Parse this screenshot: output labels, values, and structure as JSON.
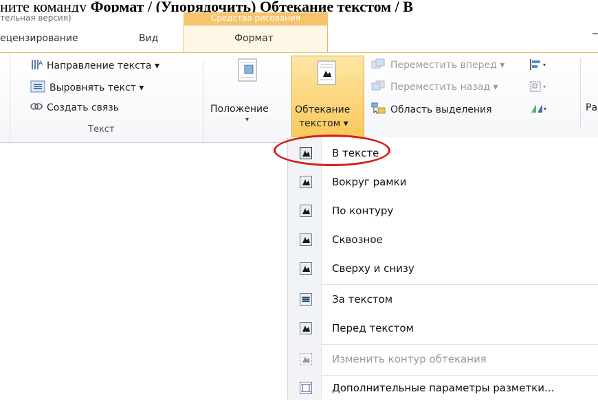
{
  "document_line": {
    "prefix": "ните команду ",
    "bold": "Формат / (Упорядочить) Обтекание текстом / В"
  },
  "ribbon": {
    "title_fragment": "тельная версия)",
    "contextual_header": "Средства рисования",
    "tabs": [
      {
        "label": "ецензирование"
      },
      {
        "label": "Вид"
      },
      {
        "label": "Формат"
      }
    ],
    "text_group": {
      "items": [
        {
          "label": "Направление текста ▾"
        },
        {
          "label": "Выровнять текст ▾"
        },
        {
          "label": "Создать связь"
        }
      ],
      "label": "Текст"
    },
    "position_button": {
      "label": "Положение",
      "arrow": "▾"
    },
    "wrap_button": {
      "line1": "Обтекание",
      "line2": "текстом ▾"
    },
    "arrange_items": [
      {
        "label": "Переместить вперед ▾"
      },
      {
        "label": "Переместить назад ▾"
      },
      {
        "label": "Область выделения"
      }
    ],
    "right_cut": "Ра"
  },
  "menu": {
    "items": [
      {
        "label": "В тексте"
      },
      {
        "label": "Вокруг рамки"
      },
      {
        "label": "По контуру"
      },
      {
        "label": "Сквозное"
      },
      {
        "label": "Сверху и снизу"
      },
      {
        "label": "За текстом"
      },
      {
        "label": "Перед текстом"
      },
      {
        "label": "Изменить контур обтекания"
      },
      {
        "label": "Дополнительные параметры разметки..."
      }
    ]
  },
  "colors": {
    "accent_tab": "#f6c46c",
    "wrap_button_bg": "#fbd982",
    "annotation_red": "#d21d1d"
  }
}
